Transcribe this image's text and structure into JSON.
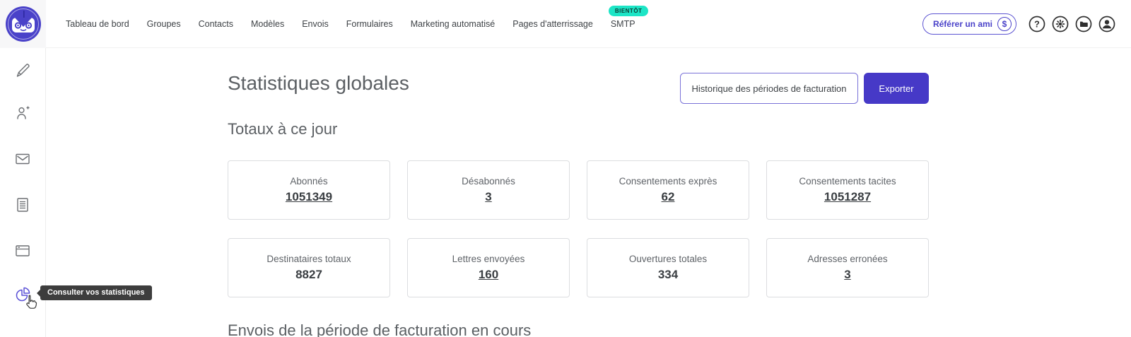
{
  "brand": {
    "logo_name": "owl-robot-logo"
  },
  "nav": {
    "items": [
      {
        "label": "Tableau de bord"
      },
      {
        "label": "Groupes"
      },
      {
        "label": "Contacts"
      },
      {
        "label": "Modèles"
      },
      {
        "label": "Envois"
      },
      {
        "label": "Formulaires"
      },
      {
        "label": "Marketing automatisé"
      },
      {
        "label": "Pages d'atterrissage"
      },
      {
        "label": "SMTP",
        "badge": "BIENTÔT"
      }
    ]
  },
  "header_actions": {
    "refer_label": "Référer un ami",
    "dollar_symbol": "$",
    "icons": [
      "help-icon",
      "settings-icon",
      "folder-icon",
      "account-icon"
    ]
  },
  "sidebar": {
    "tooltip": "Consulter vos statistiques",
    "items": [
      "design-brush",
      "add-contact",
      "mailing-envelope",
      "templates-document",
      "landing-window",
      "statistics-pie"
    ]
  },
  "main": {
    "title": "Statistiques globales",
    "billing_history_button": "Historique des périodes de facturation",
    "export_button": "Exporter",
    "totals_section_title": "Totaux à ce jour",
    "next_section_title": "Envois de la période de facturation en cours",
    "stats": [
      {
        "label": "Abonnés",
        "value": "1051349",
        "linked": true
      },
      {
        "label": "Désabonnés",
        "value": "3",
        "linked": true
      },
      {
        "label": "Consentements exprès",
        "value": "62",
        "linked": true
      },
      {
        "label": "Consentements tacites",
        "value": "1051287",
        "linked": true
      },
      {
        "label": "Destinataires totaux",
        "value": "8827",
        "linked": false
      },
      {
        "label": "Lettres envoyées",
        "value": "160",
        "linked": true
      },
      {
        "label": "Ouvertures totales",
        "value": "334",
        "linked": false
      },
      {
        "label": "Adresses erronées",
        "value": "3",
        "linked": true
      }
    ]
  },
  "colors": {
    "accent_indigo": "#4639c7",
    "badge_teal": "#1de5c6",
    "tooltip_bg": "#3d3d3d",
    "text_gray": "#5f6368",
    "value_gray": "#3a3e42",
    "card_border": "#dcdde0"
  }
}
